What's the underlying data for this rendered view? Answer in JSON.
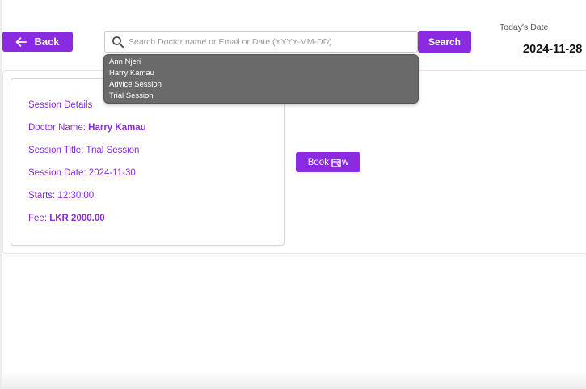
{
  "header": {
    "back_label": "Back",
    "search": {
      "placeholder": "Search Doctor name or Email or Date (YYYY-MM-DD)",
      "value": "",
      "button_label": "Search",
      "suggestions": [
        "Ann Njeri",
        "Harry Kamau",
        "Advice Session",
        "Trial Session"
      ]
    },
    "today_label": "Today's Date",
    "today_value": "2024-11-28"
  },
  "session": {
    "heading": "Session Details",
    "doctor_label": "Doctor Name: ",
    "doctor_value": "Harry Kamau",
    "title_label": "Session Title: ",
    "title_value": "Trial Session",
    "date_label": "Session Date: ",
    "date_value": "2024-11-30",
    "start_label": "Starts: ",
    "start_value": "12:30:00",
    "fee_label": "Fee: ",
    "fee_value": "LKR 2000.00",
    "book_label_start": "Book ",
    "book_label_end": "w"
  },
  "colors": {
    "accent": "#8a2be2",
    "dropdown_bg": "#6b6a6b",
    "button_text": "#ffffff"
  },
  "icons": {
    "back": "arrow-left-icon",
    "search": "search-icon",
    "book": "calendar-icon"
  }
}
